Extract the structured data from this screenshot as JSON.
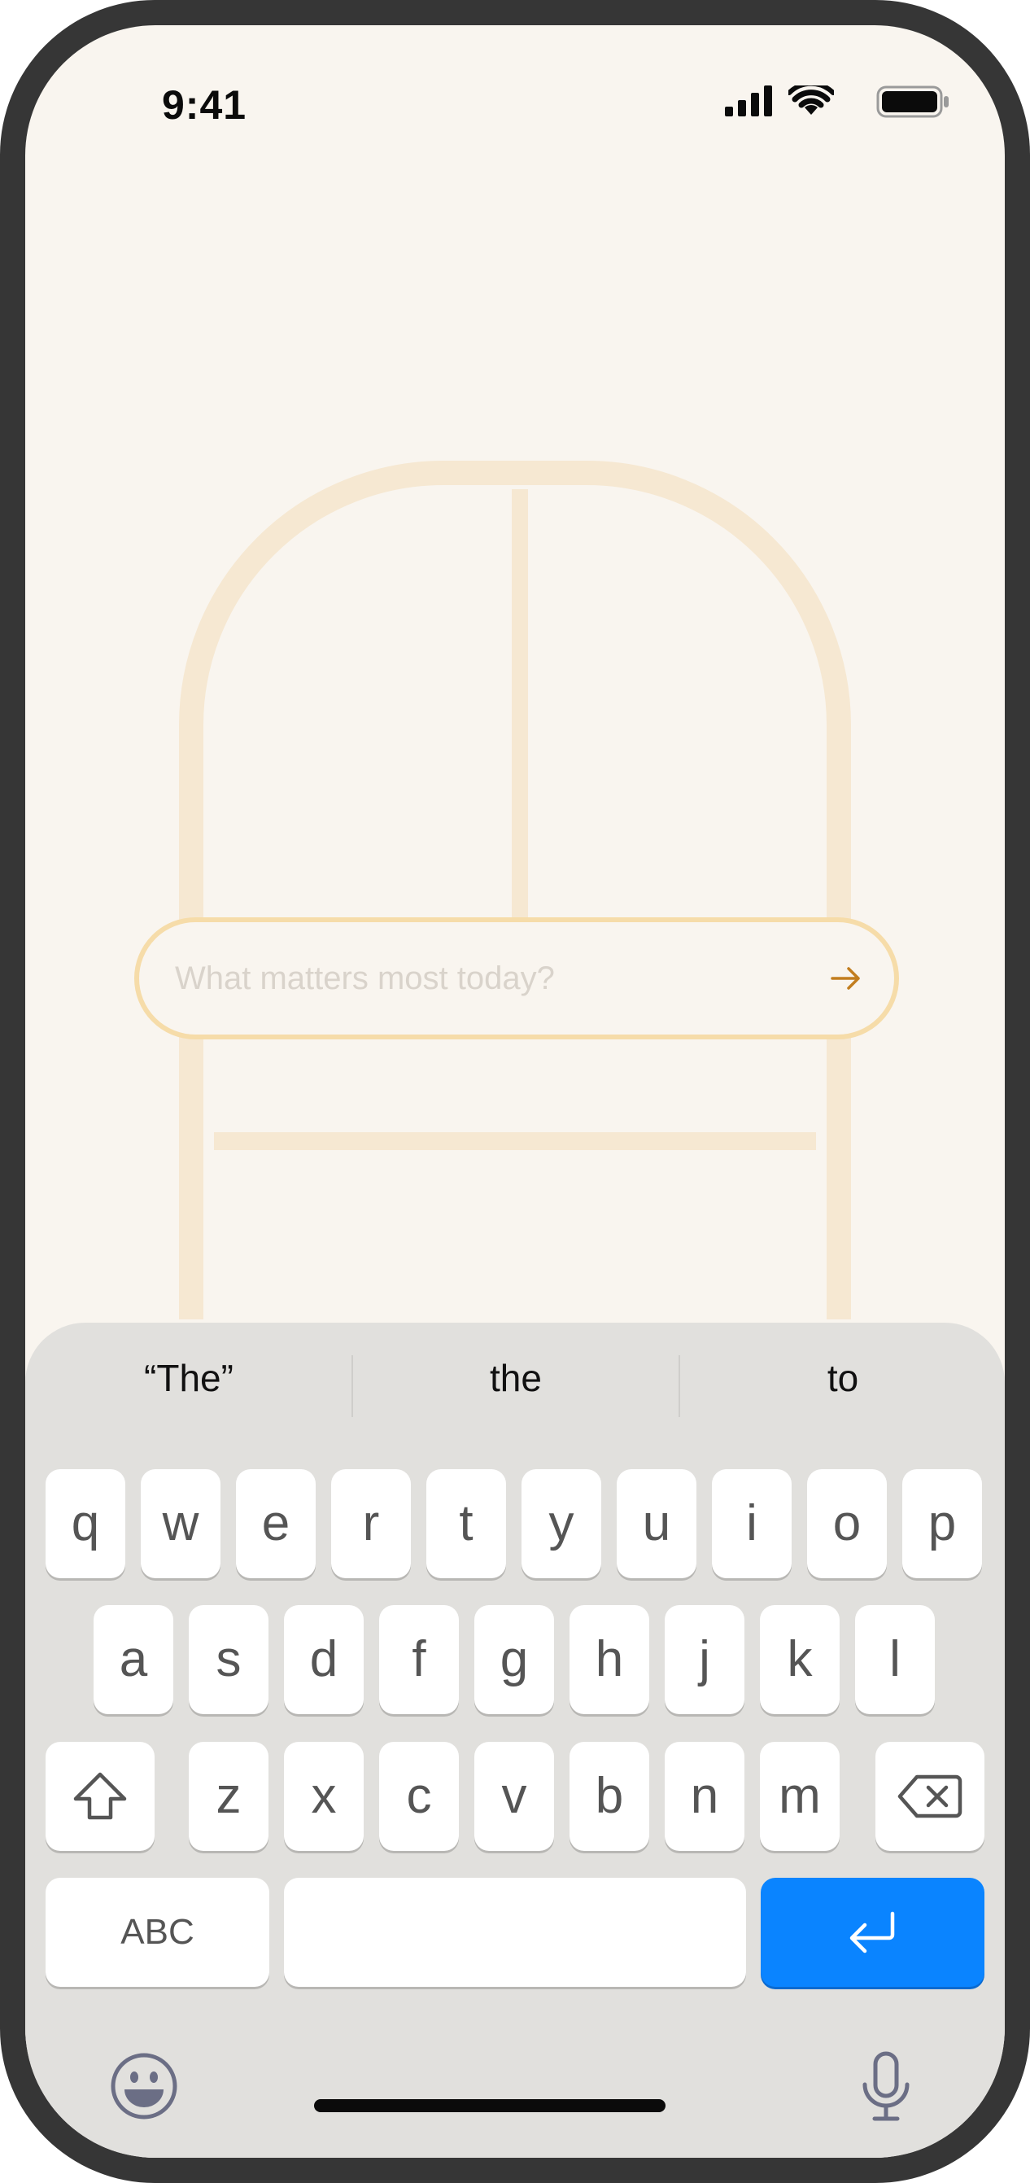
{
  "status_bar": {
    "time": "9:41",
    "icons": [
      "signal-icon",
      "wifi-icon",
      "battery-icon"
    ]
  },
  "prompt": {
    "placeholder": "What matters most today?",
    "value": "",
    "submit_icon": "arrow-right-icon"
  },
  "keyboard": {
    "suggestions": [
      "“The”",
      "the",
      "to"
    ],
    "row1": [
      "q",
      "w",
      "e",
      "r",
      "t",
      "y",
      "u",
      "i",
      "o",
      "p"
    ],
    "row2": [
      "a",
      "s",
      "d",
      "f",
      "g",
      "h",
      "j",
      "k",
      "l"
    ],
    "row3": [
      "z",
      "x",
      "c",
      "v",
      "b",
      "n",
      "m"
    ],
    "shift_icon": "shift-icon",
    "delete_icon": "delete-icon",
    "abc_label": "ABC",
    "space_label": "",
    "return_icon": "return-icon",
    "emoji_icon": "emoji-icon",
    "mic_icon": "microphone-icon"
  },
  "colors": {
    "background": "#f9f5ef",
    "accent_outline": "#f6dca9",
    "arrow": "#c27d1e",
    "keyboard_bg": "#e1e0dd",
    "return_key": "#0a84ff"
  }
}
